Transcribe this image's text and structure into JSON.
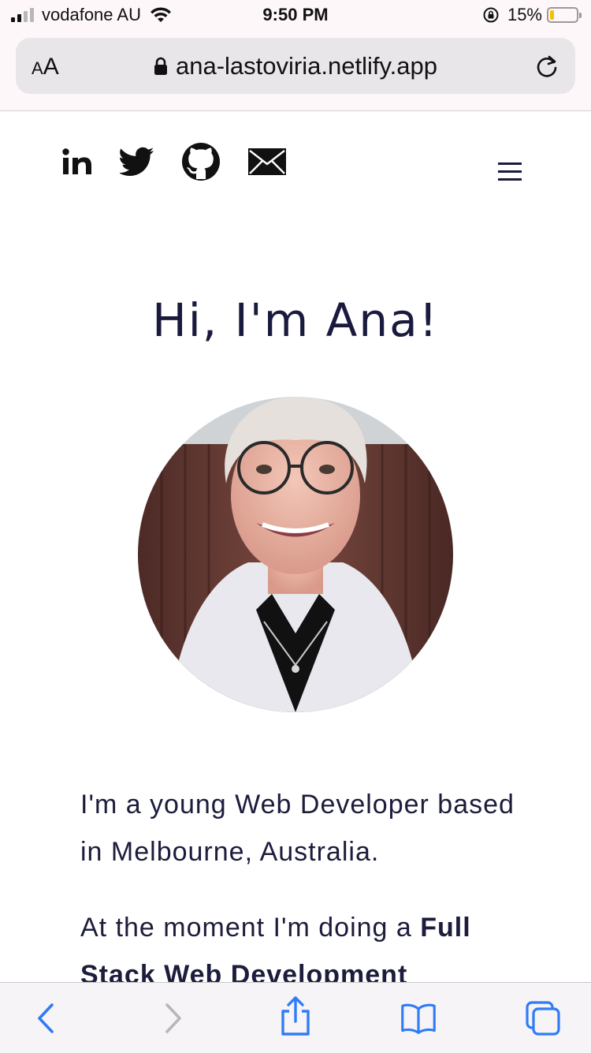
{
  "status_bar": {
    "carrier": "vodafone AU",
    "time": "9:50 PM",
    "battery_percent": "15%",
    "battery_level": 0.15
  },
  "browser": {
    "text_size_label_small": "A",
    "text_size_label_large": "A",
    "url": "ana-lastoviria.netlify.app",
    "reload_icon": "reload-icon"
  },
  "nav": {
    "social_icons": [
      "linkedin-icon",
      "twitter-icon",
      "github-icon",
      "mail-icon"
    ],
    "menu_icon": "hamburger-icon"
  },
  "hero": {
    "title": "Hi, I'm Ana!"
  },
  "bio": {
    "paragraph_1": "I'm a young Web Developer based in Melbourne, Australia.",
    "paragraph_2_prefix": "At the moment I'm doing a ",
    "paragraph_2_bold": "Full Stack Web Development"
  },
  "toolbar": {
    "icons": [
      "back-icon",
      "forward-icon",
      "share-icon",
      "bookmarks-icon",
      "tabs-icon"
    ]
  },
  "colors": {
    "heading": "#1a1a3e",
    "body_text": "#1c1c3c",
    "ios_blue": "#2f7cf6",
    "browser_chrome": "#fdf7fa"
  }
}
